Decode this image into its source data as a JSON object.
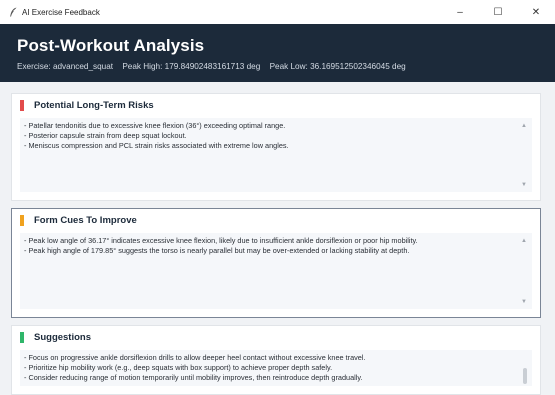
{
  "window": {
    "title": "AI Exercise Feedback",
    "app_icon": "feather-icon",
    "controls": {
      "minimize": "–",
      "maximize": "☐",
      "close": "✕"
    }
  },
  "header": {
    "title": "Post-Workout Analysis",
    "exercise": "Exercise: advanced_squat",
    "peak_high": "Peak High: 179.84902483161713 deg",
    "peak_low": "Peak Low: 36.169512502346045 deg",
    "background": "#1c2a3a"
  },
  "sections": [
    {
      "title": "Potential Long-Term Risks",
      "accent": "#e24b4b",
      "lines": [
        "- Patellar tendonitis due to excessive knee flexion (36°) exceeding optimal range.",
        "- Posterior capsule strain from deep squat lockout.",
        "- Meniscus compression and PCL strain risks associated with extreme low angles."
      ]
    },
    {
      "title": "Form Cues To Improve",
      "accent": "#f0a21f",
      "lines": [
        "- Peak low angle of 36.17° indicates excessive knee flexion, likely due to insufficient ankle dorsiflexion or poor hip mobility.",
        "- Peak high angle of 179.85° suggests the torso is nearly parallel but may be over-extended or lacking stability at depth."
      ]
    },
    {
      "title": "Suggestions",
      "accent": "#2fb66a",
      "lines": [
        "- Focus on progressive ankle dorsiflexion drills to allow deeper heel contact without excessive knee travel.",
        "- Prioritize hip mobility work (e.g., deep squats with box support) to achieve proper depth safely.",
        "- Consider reducing range of motion temporarily until mobility improves, then reintroduce depth gradually."
      ]
    }
  ]
}
